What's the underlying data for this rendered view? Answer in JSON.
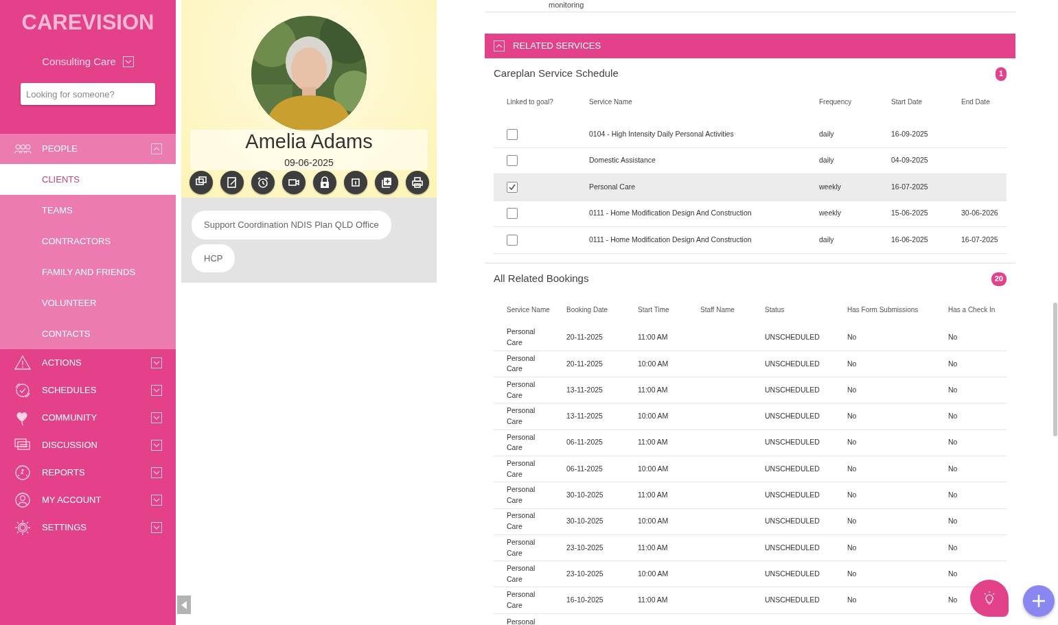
{
  "sidebar": {
    "logo": "CAREVISION",
    "organisation": "Consulting Care",
    "search": {
      "placeholder": "Looking for someone?"
    },
    "nav": [
      {
        "label": "PEOPLE",
        "expanded": true,
        "children": [
          {
            "label": "CLIENTS",
            "selected": true
          },
          {
            "label": "TEAMS",
            "selected": false
          },
          {
            "label": "CONTRACTORS",
            "selected": false
          },
          {
            "label": "FAMILY AND FRIENDS",
            "selected": false
          },
          {
            "label": "VOLUNTEER",
            "selected": false
          },
          {
            "label": "CONTACTS",
            "selected": false
          }
        ]
      },
      {
        "label": "ACTIONS",
        "expanded": false
      },
      {
        "label": "SCHEDULES",
        "expanded": false
      },
      {
        "label": "COMMUNITY",
        "expanded": false
      },
      {
        "label": "DISCUSSION",
        "expanded": false
      },
      {
        "label": "REPORTS",
        "expanded": false
      },
      {
        "label": "MY ACCOUNT",
        "expanded": false
      },
      {
        "label": "SETTINGS",
        "expanded": false
      }
    ]
  },
  "profile": {
    "name": "Amelia Adams",
    "date": "09-06-2025",
    "tags": [
      "Support Coordination NDIS Plan QLD Office",
      "HCP"
    ]
  },
  "previous_row": {
    "column_3": "monitoring"
  },
  "related_services": {
    "title": "RELATED SERVICES",
    "expanded": true,
    "schedule": {
      "title": "Careplan Service Schedule",
      "count": "1",
      "columns": [
        "Linked to goal?",
        "Service Name",
        "Frequency",
        "Start Date",
        "End Date"
      ],
      "rows": [
        {
          "checked": false,
          "selected": false,
          "service": "0104 - High Intensity Daily Personal Activities",
          "frequency": "daily",
          "start": "16-09-2025",
          "end": ""
        },
        {
          "checked": false,
          "selected": false,
          "service": "Domestic Assistance",
          "frequency": "daily",
          "start": "04-09-2025",
          "end": ""
        },
        {
          "checked": true,
          "selected": true,
          "service": "Personal Care",
          "frequency": "weekly",
          "start": "16-07-2025",
          "end": ""
        },
        {
          "checked": false,
          "selected": false,
          "service": "0111 - Home Modification Design And Construction",
          "frequency": "weekly",
          "start": "15-06-2025",
          "end": "30-06-2026"
        },
        {
          "checked": false,
          "selected": false,
          "service": "0111 - Home Modification Design And Construction",
          "frequency": "daily",
          "start": "16-06-2025",
          "end": "16-07-2025"
        }
      ]
    },
    "bookings": {
      "title": "All Related Bookings",
      "count": "20",
      "columns": [
        "Service Name",
        "Booking Date",
        "Start Time",
        "Staff Name",
        "Status",
        "Has Form Submissions",
        "Has a Check In"
      ],
      "rows": [
        [
          "Personal Care",
          "20-11-2025",
          "11:00 AM",
          "",
          "UNSCHEDULED",
          "No",
          "No"
        ],
        [
          "Personal Care",
          "20-11-2025",
          "10:00 AM",
          "",
          "UNSCHEDULED",
          "No",
          "No"
        ],
        [
          "Personal Care",
          "13-11-2025",
          "11:00 AM",
          "",
          "UNSCHEDULED",
          "No",
          "No"
        ],
        [
          "Personal Care",
          "13-11-2025",
          "10:00 AM",
          "",
          "UNSCHEDULED",
          "No",
          "No"
        ],
        [
          "Personal Care",
          "06-11-2025",
          "11:00 AM",
          "",
          "UNSCHEDULED",
          "No",
          "No"
        ],
        [
          "Personal Care",
          "06-11-2025",
          "10:00 AM",
          "",
          "UNSCHEDULED",
          "No",
          "No"
        ],
        [
          "Personal Care",
          "30-10-2025",
          "11:00 AM",
          "",
          "UNSCHEDULED",
          "No",
          "No"
        ],
        [
          "Personal Care",
          "30-10-2025",
          "10:00 AM",
          "",
          "UNSCHEDULED",
          "No",
          "No"
        ],
        [
          "Personal Care",
          "23-10-2025",
          "11:00 AM",
          "",
          "UNSCHEDULED",
          "No",
          "No"
        ],
        [
          "Personal Care",
          "23-10-2025",
          "10:00 AM",
          "",
          "UNSCHEDULED",
          "No",
          "No"
        ],
        [
          "Personal Care",
          "16-10-2025",
          "11:00 AM",
          "",
          "UNSCHEDULED",
          "No",
          "No"
        ],
        [
          "Personal"
        ]
      ]
    }
  }
}
